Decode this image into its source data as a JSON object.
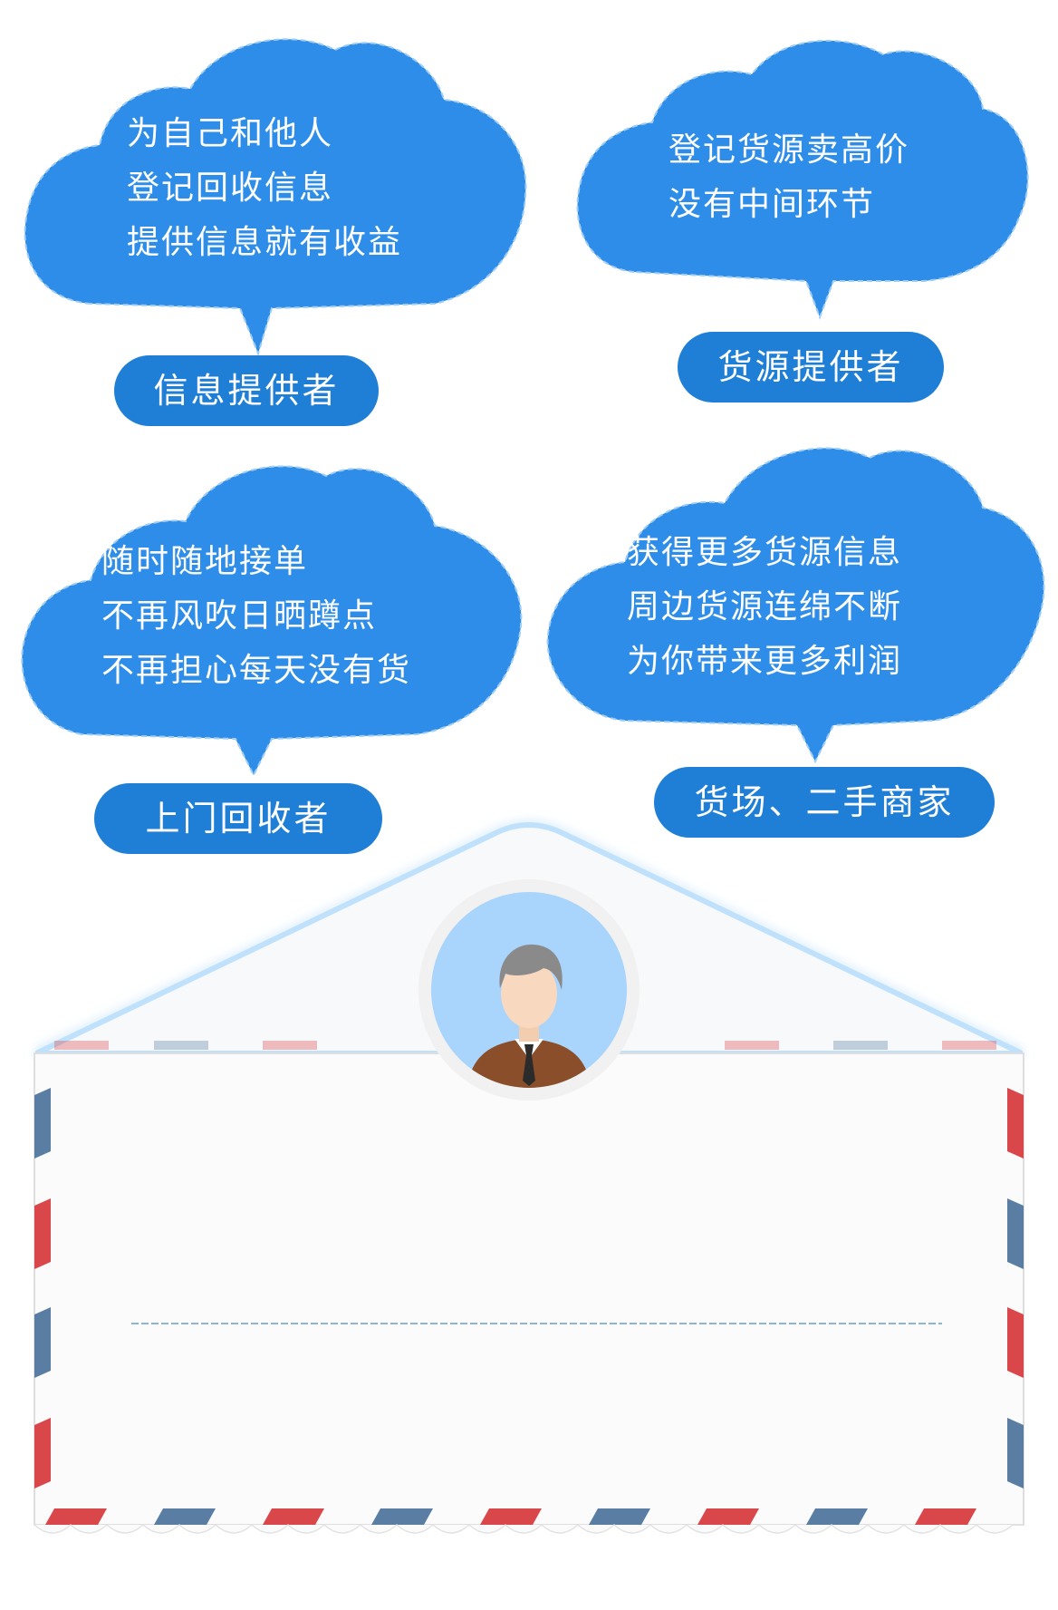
{
  "colors": {
    "bubble": "#2d8de8",
    "pill": "#1f7fd6",
    "text": "#ffffff",
    "stripe_red": "#d9474a",
    "stripe_blue": "#5a7ea3",
    "avatar_bg": "#a9d4fb"
  },
  "clouds": [
    {
      "lines": [
        "为自己和他人",
        "登记回收信息",
        "提供信息就有收益"
      ],
      "role": "信息提供者"
    },
    {
      "lines": [
        "登记货源卖高价",
        "没有中间环节"
      ],
      "role": "货源提供者"
    },
    {
      "lines": [
        "随时随地接单",
        "不再风吹日晒蹲点",
        "不再担心每天没有货"
      ],
      "role": "上门回收者"
    },
    {
      "lines": [
        "获得更多货源信息",
        "周边货源连绵不断",
        "为你带来更多利润"
      ],
      "role": "货场、二手商家"
    }
  ],
  "envelope": {
    "avatar": "user-avatar-icon"
  }
}
